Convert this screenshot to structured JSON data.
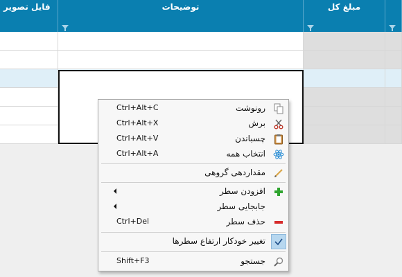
{
  "grid": {
    "columns": [
      {
        "label": "فایل تصویر"
      },
      {
        "label": "توضیحات"
      },
      {
        "label": "مبلغ کل"
      },
      {
        "label": ""
      }
    ]
  },
  "context_menu": {
    "items": [
      {
        "label": "رونوشت",
        "shortcut": "Ctrl+Alt+C",
        "icon": "copy-icon"
      },
      {
        "label": "برش",
        "shortcut": "Ctrl+Alt+X",
        "icon": "scissors-icon"
      },
      {
        "label": "چسباندن",
        "shortcut": "Ctrl+Alt+V",
        "icon": "clipboard-icon"
      },
      {
        "label": "انتخاب همه",
        "shortcut": "Ctrl+Alt+A",
        "icon": "select-all-icon"
      },
      {
        "label": "مقداردهی گروهی",
        "shortcut": "",
        "icon": "pencil-icon"
      },
      {
        "label": "افزودن سطر",
        "shortcut": "",
        "icon": "plus-icon"
      },
      {
        "label": "جابجایی سطر",
        "shortcut": "",
        "icon": ""
      },
      {
        "label": "حذف سطر",
        "shortcut": "Ctrl+Del",
        "icon": "minus-icon"
      },
      {
        "label": "تغییر خودکار ارتفاع سطرها",
        "shortcut": "",
        "icon": "checkmark-icon"
      },
      {
        "label": "جستجو",
        "shortcut": "Shift+F3",
        "icon": "magnifier-icon"
      }
    ]
  },
  "colors": {
    "header": "#0a7fb0",
    "selected_row": "#dfeff8",
    "menu_bg": "#f7f7f7"
  }
}
